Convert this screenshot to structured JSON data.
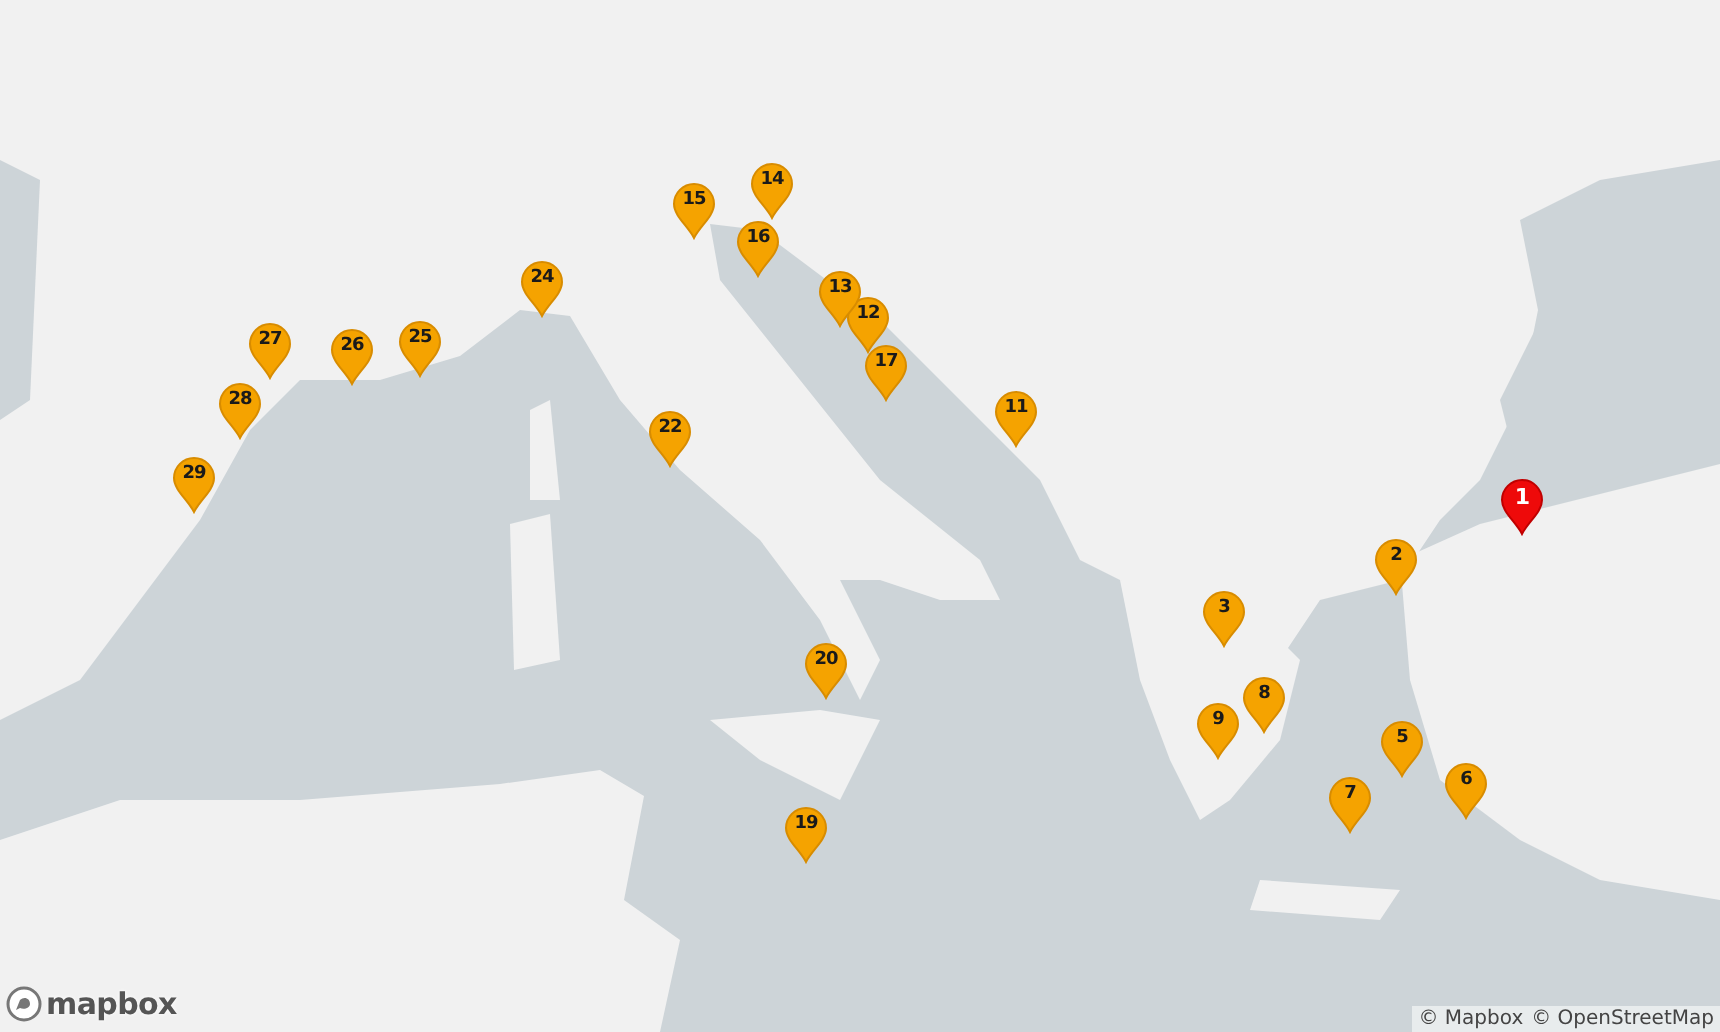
{
  "map": {
    "markers": [
      {
        "label": "1",
        "selected": true
      },
      {
        "label": "2",
        "selected": false
      },
      {
        "label": "3",
        "selected": false
      },
      {
        "label": "5",
        "selected": false
      },
      {
        "label": "6",
        "selected": false
      },
      {
        "label": "7",
        "selected": false
      },
      {
        "label": "8",
        "selected": false
      },
      {
        "label": "9",
        "selected": false
      },
      {
        "label": "11",
        "selected": false
      },
      {
        "label": "12",
        "selected": false
      },
      {
        "label": "13",
        "selected": false
      },
      {
        "label": "14",
        "selected": false
      },
      {
        "label": "15",
        "selected": false
      },
      {
        "label": "16",
        "selected": false
      },
      {
        "label": "17",
        "selected": false
      },
      {
        "label": "19",
        "selected": false
      },
      {
        "label": "20",
        "selected": false
      },
      {
        "label": "22",
        "selected": false
      },
      {
        "label": "24",
        "selected": false
      },
      {
        "label": "25",
        "selected": false
      },
      {
        "label": "26",
        "selected": false
      },
      {
        "label": "27",
        "selected": false
      },
      {
        "label": "28",
        "selected": false
      },
      {
        "label": "29",
        "selected": false
      }
    ]
  },
  "logo": {
    "text": "mapbox"
  },
  "attribution": [
    "© Mapbox",
    "© OpenStreetMap"
  ]
}
